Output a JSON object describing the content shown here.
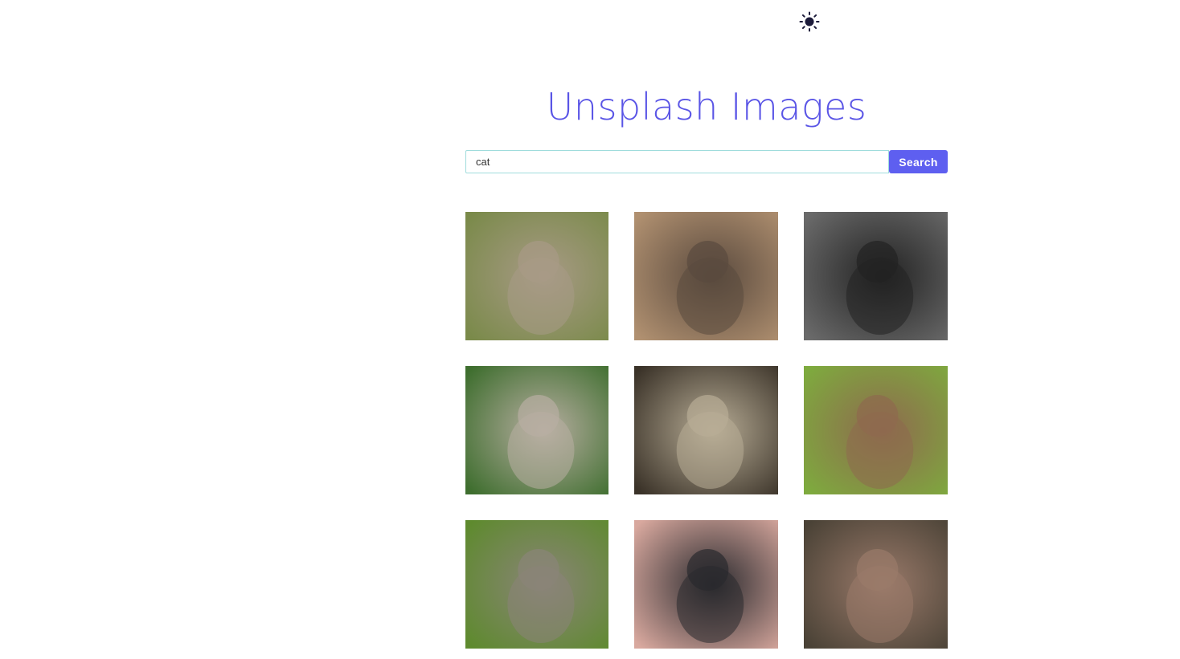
{
  "theme_toggle": {
    "icon": "sun-icon"
  },
  "header": {
    "title": "Unsplash Images"
  },
  "search": {
    "value": "cat",
    "placeholder": "",
    "button_label": "Search"
  },
  "images": [
    {
      "name": "macaque-baby-image",
      "palette": [
        "#7a8a4a",
        "#a89a86"
      ]
    },
    {
      "name": "macaque-face-image",
      "palette": [
        "#b09070",
        "#5a4a3e"
      ]
    },
    {
      "name": "chimpanzee-bw-image",
      "palette": [
        "#6a6a6a",
        "#222222"
      ]
    },
    {
      "name": "macaques-group-image",
      "palette": [
        "#3e6e2e",
        "#b8aea2"
      ]
    },
    {
      "name": "monkey-window-image",
      "palette": [
        "#3a3228",
        "#b8ad96"
      ]
    },
    {
      "name": "monkey-eating-image",
      "palette": [
        "#7eaa3e",
        "#8e6a4e"
      ]
    },
    {
      "name": "monkey-with-baby-image",
      "palette": [
        "#5e8a2e",
        "#8a8478"
      ]
    },
    {
      "name": "gorilla-image",
      "palette": [
        "#d8a89e",
        "#2a2a2e"
      ]
    },
    {
      "name": "monkey-sitting-ground-image",
      "palette": [
        "#4a4236",
        "#9a7a6a"
      ]
    }
  ]
}
